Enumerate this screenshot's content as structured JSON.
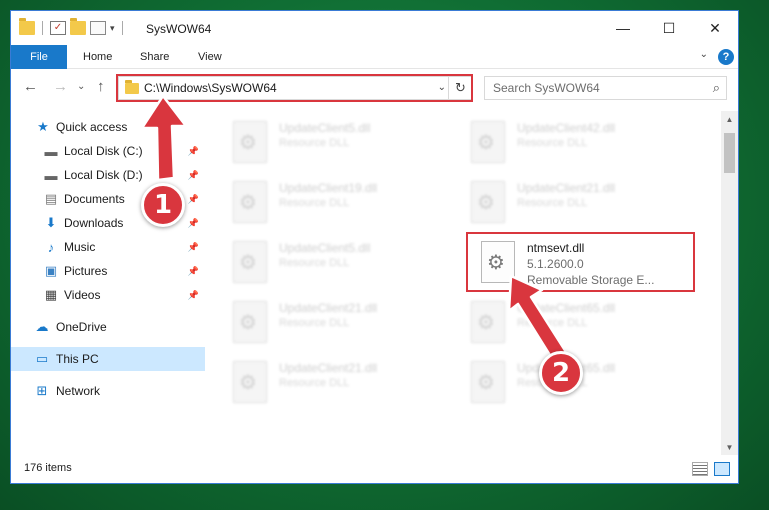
{
  "window": {
    "title": "SysWOW64",
    "controls": {
      "minimize": "—",
      "maximize": "☐",
      "close": "✕"
    }
  },
  "ribbon": {
    "tabs": [
      "File",
      "Home",
      "Share",
      "View"
    ],
    "help": "?"
  },
  "navigation": {
    "address": "C:\\Windows\\SysWOW64",
    "search_placeholder": "Search SysWOW64"
  },
  "sidebar": {
    "items": [
      {
        "label": "Quick access",
        "icon": "star-icon"
      },
      {
        "label": "Local Disk (C:)",
        "icon": "drive-icon",
        "pinned": true
      },
      {
        "label": "Local Disk (D:)",
        "icon": "drive-icon",
        "pinned": true
      },
      {
        "label": "Documents",
        "icon": "documents-icon",
        "pinned": true
      },
      {
        "label": "Downloads",
        "icon": "download-icon",
        "pinned": true
      },
      {
        "label": "Music",
        "icon": "music-icon",
        "pinned": true
      },
      {
        "label": "Pictures",
        "icon": "pictures-icon",
        "pinned": true
      },
      {
        "label": "Videos",
        "icon": "videos-icon",
        "pinned": true
      },
      {
        "label": "OneDrive",
        "icon": "cloud-icon"
      },
      {
        "label": "This PC",
        "icon": "computer-icon",
        "selected": true
      },
      {
        "label": "Network",
        "icon": "network-icon"
      }
    ]
  },
  "files": [
    {
      "name": "UpdateClient5.dll",
      "type": "Resource DLL"
    },
    {
      "name": "UpdateClient42.dll",
      "type": "Resource DLL"
    },
    {
      "name": "UpdateClient19.dll",
      "type": "Resource DLL"
    },
    {
      "name": "UpdateClient21.dll",
      "type": "Resource DLL"
    },
    {
      "name": "UpdateClient5.dll",
      "type": "Resource DLL"
    },
    {
      "name": "ntmsevt.dll",
      "version": "5.1.2600.0",
      "type": "Removable Storage E..."
    },
    {
      "name": "UpdateClient21.dll",
      "type": "Resource DLL"
    },
    {
      "name": "UpdateClient65.dll",
      "type": "Resource DLL"
    },
    {
      "name": "UpdateClient21.dll",
      "type": "Resource DLL"
    },
    {
      "name": "UpdateClient65.dll",
      "type": "Resource DLL"
    }
  ],
  "status": {
    "item_count": "176 items"
  },
  "annotations": {
    "step1": "1",
    "step2": "2"
  },
  "colors": {
    "accent": "#1979ca",
    "highlight": "#d9363e",
    "selected_bg": "#cce8ff"
  }
}
